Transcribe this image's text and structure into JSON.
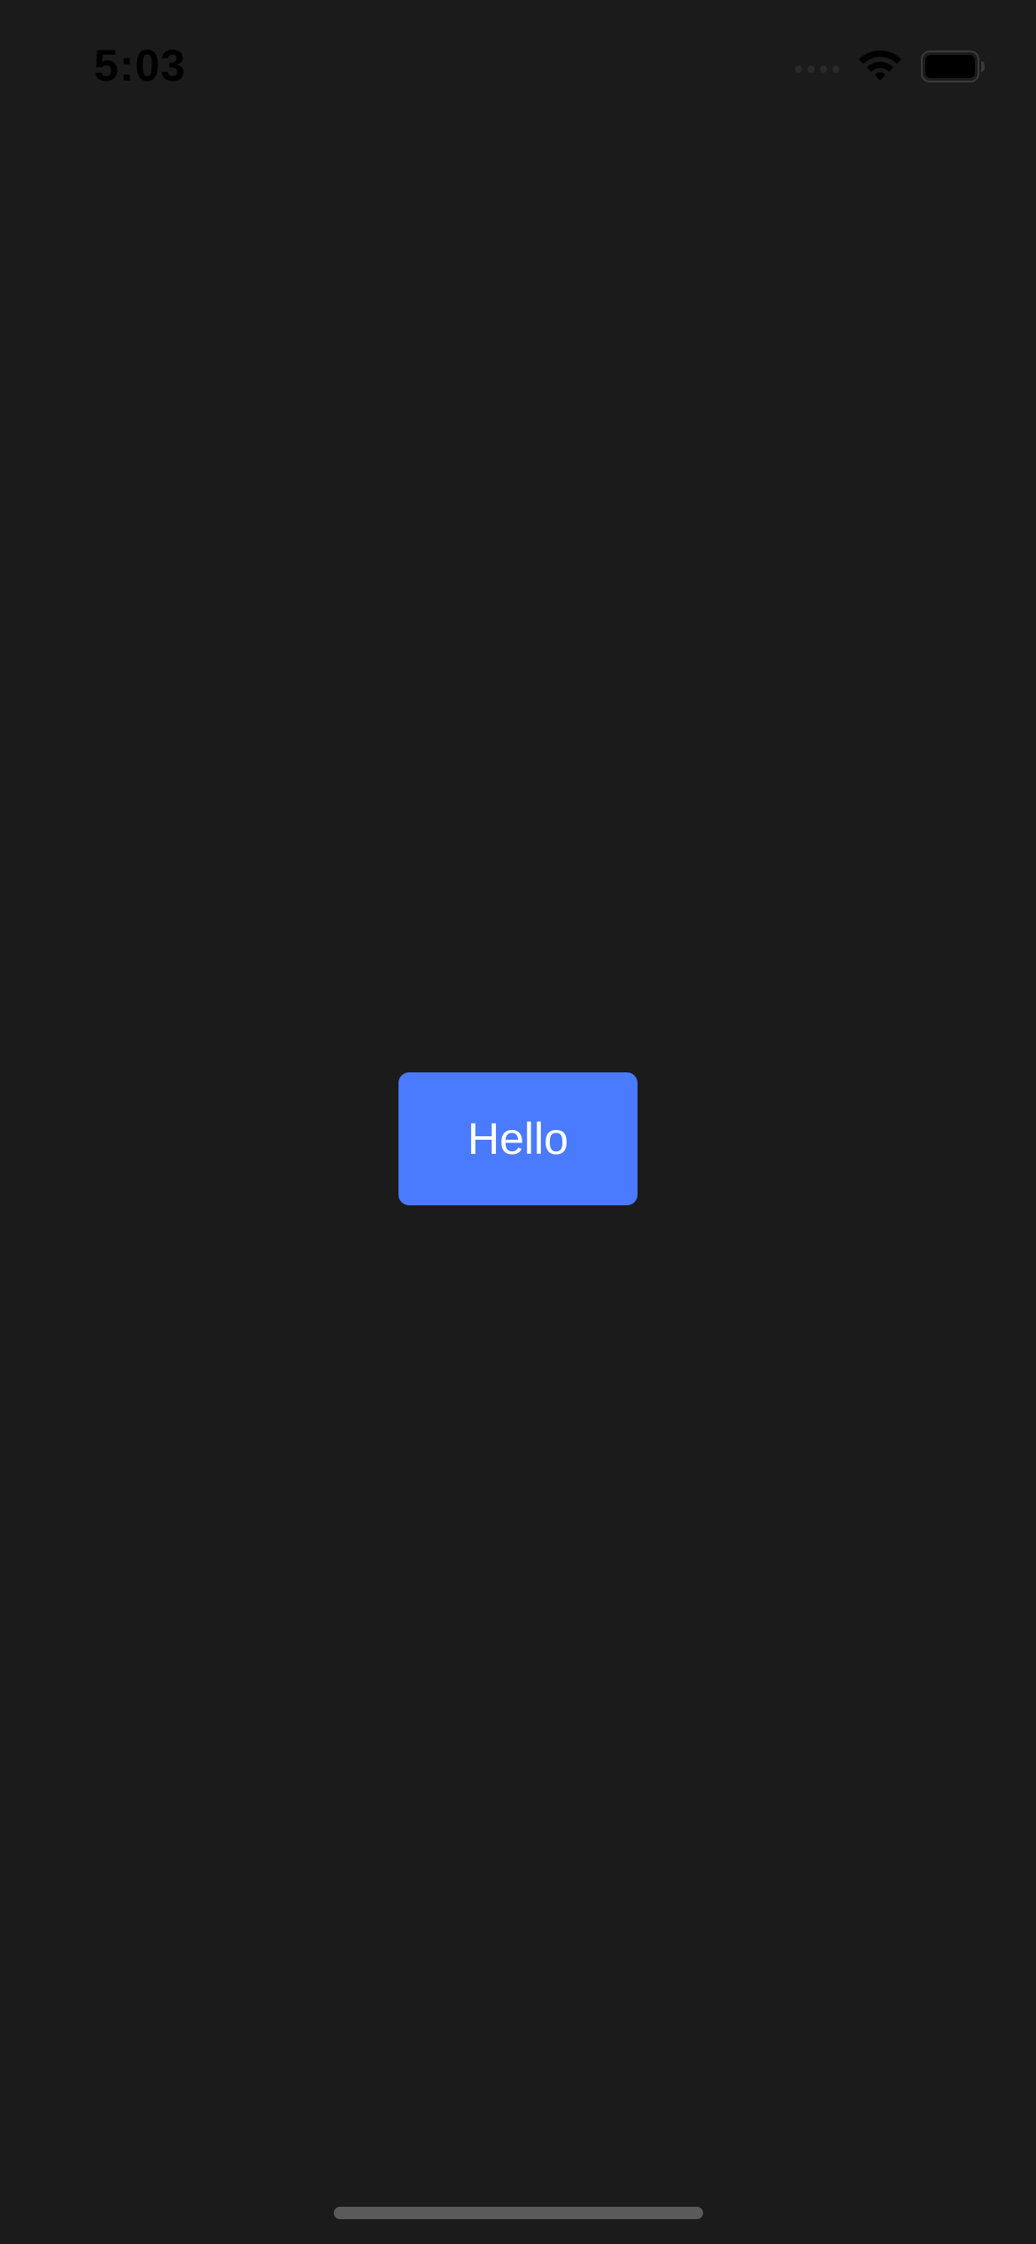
{
  "status_bar": {
    "time": "5:03",
    "icons": [
      "signal-icon",
      "wifi-icon",
      "battery-icon"
    ]
  },
  "main": {
    "button_label": "Hello"
  },
  "colors": {
    "background": "#1b1b1b",
    "button": "#4a7afe",
    "button_text": "#ffffff",
    "status_text": "#000000",
    "home_indicator": "#5a5a5a"
  }
}
